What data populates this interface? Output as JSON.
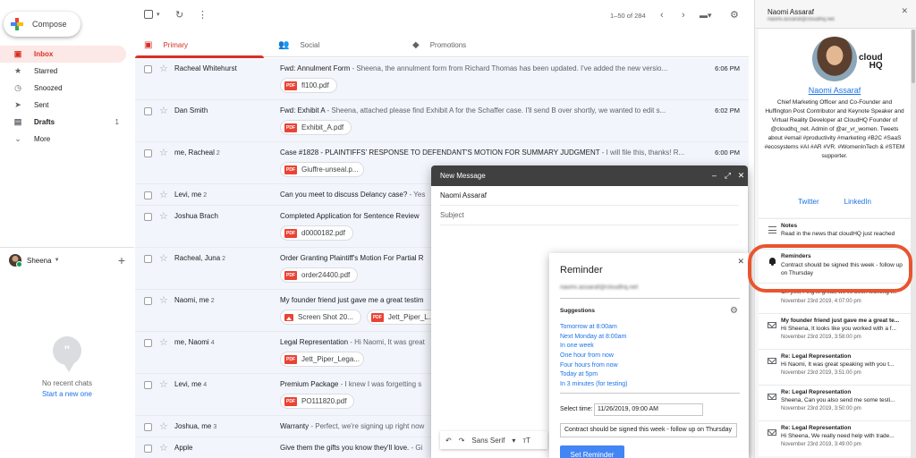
{
  "sidebar": {
    "compose_label": "Compose",
    "items": [
      {
        "label": "Inbox",
        "icon": "inbox-icon",
        "count": ""
      },
      {
        "label": "Starred",
        "icon": "star-icon",
        "count": ""
      },
      {
        "label": "Snoozed",
        "icon": "clock-icon",
        "count": ""
      },
      {
        "label": "Sent",
        "icon": "send-icon",
        "count": ""
      },
      {
        "label": "Drafts",
        "icon": "draft-icon",
        "count": "1"
      },
      {
        "label": "More",
        "icon": "chevron-down-icon",
        "count": ""
      }
    ],
    "hangouts_user": "Sheena",
    "no_chats": "No recent chats",
    "start_chat": "Start a new one"
  },
  "toolbar": {
    "pager": "1–50 of 284"
  },
  "tabs": [
    {
      "label": "Primary"
    },
    {
      "label": "Social"
    },
    {
      "label": "Promotions"
    }
  ],
  "emails": [
    {
      "sender": "Racheal Whitehurst",
      "count": "",
      "subject": "Fwd: Annulment Form",
      "snippet": " - Sheena, the annulment form from Richard Thomas has been updated. I've added the new versio...",
      "time": "6:06 PM",
      "attachments": [
        "fl100.pdf"
      ]
    },
    {
      "sender": "Dan Smith",
      "count": "",
      "subject": "Fwd: Exhibit A",
      "snippet": " - Sheena, attached please find Exhibit A for the Schaffer case. I'll send B over shortly, we wanted to edit s...",
      "time": "6:02 PM",
      "attachments": [
        "Exhibit_A.pdf"
      ]
    },
    {
      "sender": "me, Racheal",
      "count": "2",
      "subject": "Case #1828 - PLAINTIFFS' RESPONSE TO DEFENDANT'S MOTION FOR SUMMARY JUDGMENT",
      "snippet": " - I will file this, thanks! R...",
      "time": "6:00 PM",
      "attachments": [
        "Giuffre-unseal.p..."
      ]
    },
    {
      "sender": "Levi, me",
      "count": "2",
      "subject": "Can you meet to discuss Delancy case?",
      "snippet": " - Yes",
      "time": "",
      "attachments": []
    },
    {
      "sender": "Joshua Brach",
      "count": "",
      "subject": "Completed Application for Sentence Review",
      "snippet": "",
      "time": "",
      "attachments": [
        "d0000182.pdf"
      ]
    },
    {
      "sender": "Racheal, Juna",
      "count": "2",
      "subject": "Order Granting Plaintiff's Motion For Partial R",
      "snippet": "",
      "time": "",
      "attachments": [
        "order24400.pdf"
      ]
    },
    {
      "sender": "Naomi, me",
      "count": "2",
      "subject": "My founder friend just gave me a great testim",
      "snippet": "",
      "time": "",
      "attachments": [
        "Screen Shot 20...",
        "Jett_Piper_L..."
      ]
    },
    {
      "sender": "me, Naomi",
      "count": "4",
      "subject": "Legal Representation",
      "snippet": " - Hi Naomi, It was great",
      "time": "",
      "attachments": [
        "Jett_Piper_Lega..."
      ]
    },
    {
      "sender": "Levi, me",
      "count": "4",
      "subject": "Premium Package",
      "snippet": " - I knew I was forgetting s",
      "time": "",
      "attachments": [
        "PO111820.pdf"
      ]
    },
    {
      "sender": "Joshua, me",
      "count": "3",
      "subject": "Warranty",
      "snippet": " - Perfect, we're signing up right now",
      "time": "",
      "attachments": []
    },
    {
      "sender": "Apple",
      "count": "",
      "subject": "Give them the gifts you know they'll love.",
      "snippet": " - Gi",
      "time": "",
      "attachments": []
    }
  ],
  "composer": {
    "title": "New Message",
    "to": "Naomi Assaraf",
    "subject_placeholder": "Subject",
    "font": "Sans Serif"
  },
  "reminder": {
    "title": "Reminder",
    "email": "naomi.assaraf@cloudhq.net",
    "suggestions_label": "Suggestions",
    "options": [
      "Tomorrow at 8:00am",
      "Next Monday at 8:00am",
      "In one week",
      "One hour from now",
      "Four hours from now",
      "Today at 5pm",
      "In 3 minutes (for testing)"
    ],
    "select_time_label": "Select time:",
    "select_time_value": "11/26/2019, 09:00 AM",
    "note": "Contract should be signed this week - follow up on Thursday",
    "set_button": "Set Reminder"
  },
  "contact": {
    "header_name": "Naomi Assaraf",
    "header_email": "naomi.assaraf@cloudhq.net",
    "brand_line1": "cloud",
    "brand_line2": "HQ",
    "name": "Naomi Assaraf",
    "bio": "Chief Marketing Officer and Co-Founder and Huffington Post Contributor and Keynote Speaker and Virtual Reality Developer at CloudHQ Founder of @cloudhq_net. Admin of @ar_vr_women. Tweets about #email #productivity #marketing #B2C #SaaS #ecosystems #AI #AR #VR. #WomenInTech & #STEM supporter.",
    "twitter": "Twitter",
    "linkedin": "LinkedIn"
  },
  "feed": [
    {
      "title": "Notes",
      "desc": "Read in the news that cloudHQ just reached",
      "date": ""
    },
    {
      "title": "Reminders",
      "desc": "Contract should be signed this week - follow up on Thursday",
      "date": ""
    },
    {
      "title": "",
      "desc": "Oh yes, Ping is great, we've been working t...",
      "date": "November 23rd 2019, 4:07:00 pm"
    },
    {
      "title": "My founder friend just gave me a great te...",
      "desc": "Hi Sheena, It looks like you worked with a f...",
      "date": "November 23rd 2019, 3:58:00 pm"
    },
    {
      "title": "Re: Legal Representation",
      "desc": "Hi Naomi, It was great speaking with you t...",
      "date": "November 23rd 2019, 3:51:00 pm"
    },
    {
      "title": "Re: Legal Representation",
      "desc": "Sheena, Can you also send me some testi...",
      "date": "November 23rd 2019, 3:50:00 pm"
    },
    {
      "title": "Re: Legal Representation",
      "desc": "Hi Sheena, We really need help with trade...",
      "date": "November 23rd 2019, 3:49:00 pm"
    }
  ]
}
